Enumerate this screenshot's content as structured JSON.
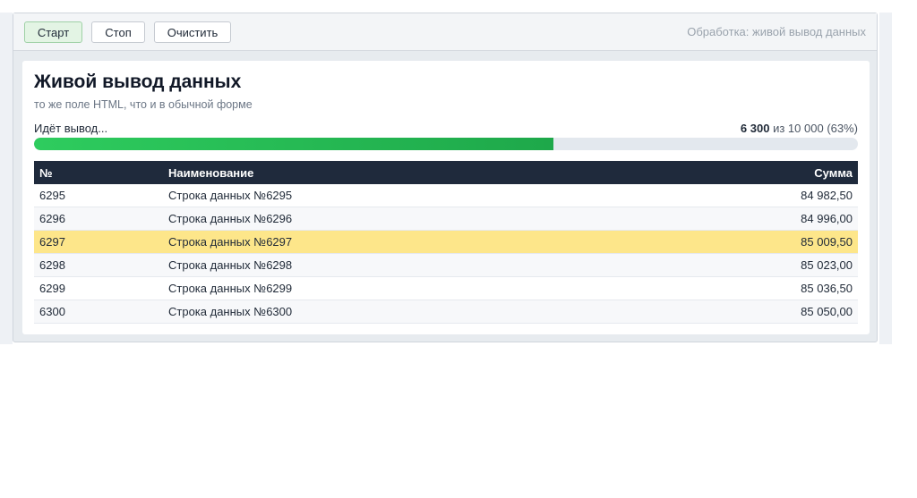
{
  "toolbar": {
    "start_label": "Старт",
    "stop_label": "Стоп",
    "clear_label": "Очистить",
    "status": "Обработка: живой вывод данных"
  },
  "panel": {
    "title": "Живой вывод данных",
    "subtitle": "то же поле HTML, что и в обычной форме"
  },
  "progress": {
    "label": "Идёт вывод...",
    "current": "6 300",
    "of_word": "из",
    "total": "10 000",
    "percent_text": "(63%)",
    "fraction": 0.63
  },
  "table": {
    "columns": [
      "№",
      "Наименование",
      "Сумма"
    ],
    "rows": [
      {
        "num": "6295",
        "name": "Строка данных №6295",
        "sum": "84 982,50"
      },
      {
        "num": "6296",
        "name": "Строка данных №6296",
        "sum": "84 996,00"
      },
      {
        "num": "6297",
        "name": "Строка данных №6297",
        "sum": "85 009,50"
      },
      {
        "num": "6298",
        "name": "Строка данных №6298",
        "sum": "85 023,00"
      },
      {
        "num": "6299",
        "name": "Строка данных №6299",
        "sum": "85 036,50"
      },
      {
        "num": "6300",
        "name": "Строка данных №6300",
        "sum": "85 050,00"
      }
    ],
    "highlight_row": 2
  },
  "colors": {
    "accent_green": "#22b14c",
    "highlight": "#fde68a",
    "header_bg": "#1f2a3c"
  }
}
